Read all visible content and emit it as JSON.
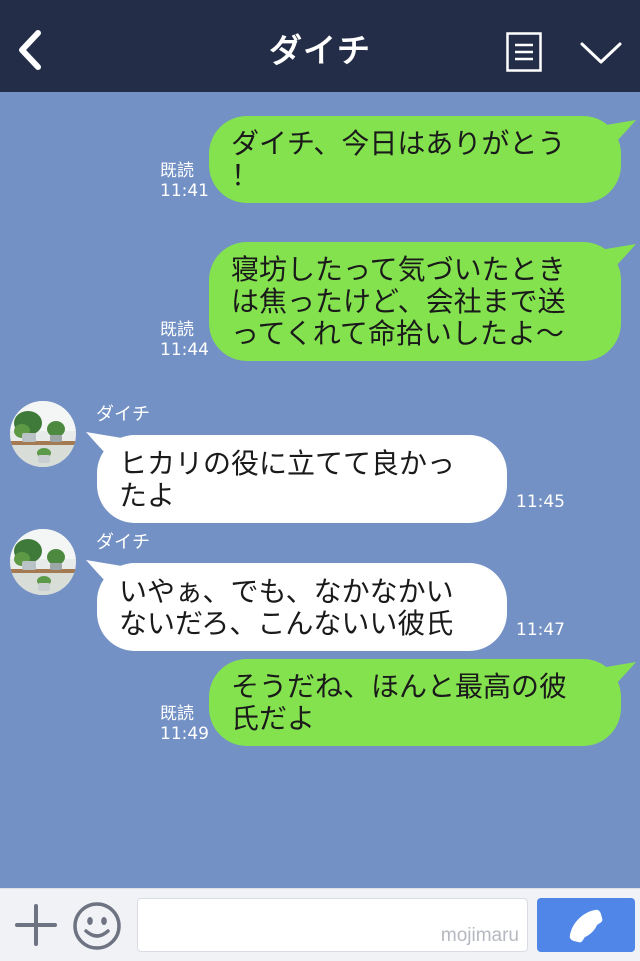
{
  "header": {
    "title": "ダイチ",
    "colors": {
      "background": "#232d47",
      "text": "#ffffff"
    },
    "icons": [
      "back-arrow-icon",
      "menu-icon",
      "chevron-down-icon"
    ]
  },
  "chat": {
    "background": "#7391c4",
    "sent_bubble_color": "#84e24f",
    "received_bubble_color": "#ffffff",
    "messages": [
      {
        "direction": "sent",
        "text": "ダイチ、今日はありがとう\n！",
        "read_label": "既読",
        "time": "11:41"
      },
      {
        "direction": "sent",
        "text": "寝坊したって気づいたとき\nは焦ったけど、会社まで送\nってくれて命拾いしたよ～",
        "read_label": "既読",
        "time": "11:44"
      },
      {
        "direction": "received",
        "sender": "ダイチ",
        "text": "ヒカリの役に立てて良かっ\nたよ",
        "time": "11:45"
      },
      {
        "direction": "received",
        "sender": "ダイチ",
        "text": "いやぁ、でも、なかなかい\nないだろ、こんないい彼氏",
        "time": "11:47"
      },
      {
        "direction": "sent",
        "text": "そうだね、ほんと最高の彼\n氏だよ",
        "read_label": "既読",
        "time": "11:49"
      }
    ]
  },
  "input_bar": {
    "watermark": "mojimaru",
    "icons": [
      "plus-icon",
      "emoji-icon",
      "phone-icon"
    ],
    "call_button_color": "#4f86e8"
  }
}
